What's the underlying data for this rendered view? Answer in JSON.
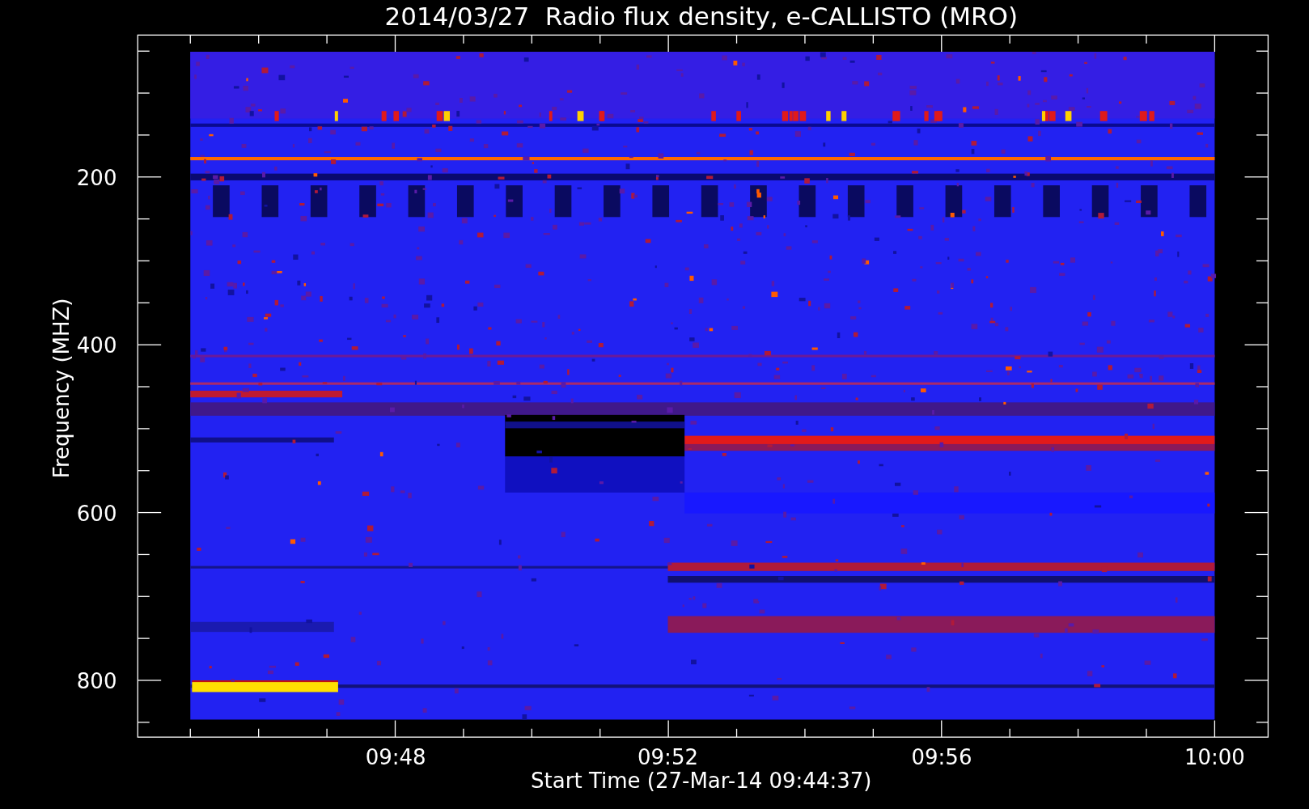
{
  "title": "2014/03/27  Radio flux density, e-CALLISTO (MRO)",
  "y_axis": {
    "label": "Frequency (MHZ)",
    "ticks": [
      "200",
      "400",
      "600",
      "800"
    ]
  },
  "x_axis": {
    "label": "Start Time (27-Mar-14 09:44:37)",
    "ticks": [
      "09:48",
      "09:52",
      "09:56",
      "10:00"
    ]
  }
}
